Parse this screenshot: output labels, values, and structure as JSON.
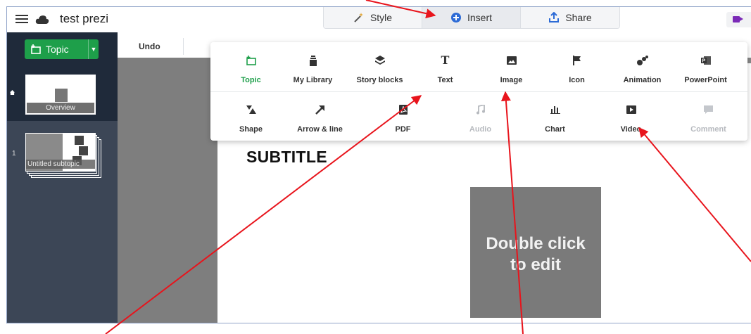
{
  "app": {
    "title": "test prezi"
  },
  "tabs": [
    {
      "label": "Style",
      "icon": "magic-wand-icon"
    },
    {
      "label": "Insert",
      "icon": "plus-circle-icon",
      "active": true
    },
    {
      "label": "Share",
      "icon": "share-upload-icon"
    }
  ],
  "sidebar": {
    "topic_button": "Topic",
    "overview_label": "Overview",
    "slide_number": "1",
    "slide_label": "Untitled subtopic"
  },
  "toolbar": {
    "undo_label": "Undo"
  },
  "canvas": {
    "subtitle": "SUBTITLE",
    "edit_line1": "Double click",
    "edit_line2": "to edit"
  },
  "insert_panel": {
    "row1": [
      {
        "label": "Topic",
        "icon": "topic-icon",
        "selected": true
      },
      {
        "label": "My Library",
        "icon": "library-icon"
      },
      {
        "label": "Story blocks",
        "icon": "story-blocks-icon"
      },
      {
        "label": "Text",
        "icon": "text-icon"
      },
      {
        "label": "Image",
        "icon": "image-icon"
      },
      {
        "label": "Icon",
        "icon": "flag-icon"
      },
      {
        "label": "Animation",
        "icon": "animation-icon"
      },
      {
        "label": "PowerPoint",
        "icon": "powerpoint-icon"
      }
    ],
    "row2": [
      {
        "label": "Shape",
        "icon": "shape-icon"
      },
      {
        "label": "Arrow & line",
        "icon": "arrow-line-icon"
      },
      {
        "label": "PDF",
        "icon": "pdf-icon"
      },
      {
        "label": "Audio",
        "icon": "audio-icon",
        "disabled": true
      },
      {
        "label": "Chart",
        "icon": "chart-icon"
      },
      {
        "label": "Video",
        "icon": "video-icon"
      },
      {
        "label": "Comment",
        "icon": "comment-icon",
        "disabled": true
      }
    ]
  },
  "colors": {
    "accent_green": "#1e9f4a",
    "sidebar_dark": "#1f2a3a",
    "annotation_red": "#e8141c",
    "insert_blue": "#2d6bd6"
  }
}
